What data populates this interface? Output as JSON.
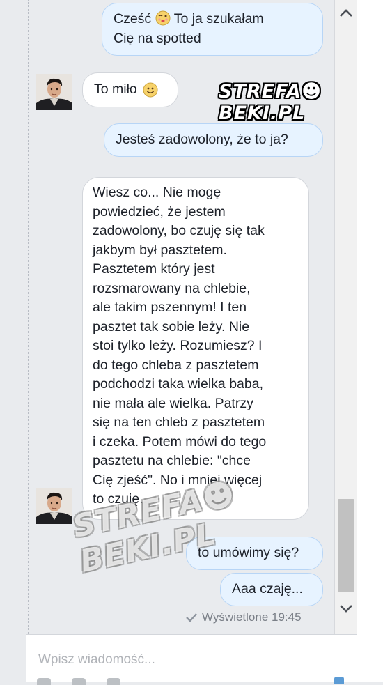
{
  "messages": [
    {
      "id": "m1",
      "side": "out",
      "text_before": "Cześć",
      "emoji": "kiss-emoji",
      "text_after": "To ja szukałam",
      "line2": "Cię na spotted"
    },
    {
      "id": "m2",
      "side": "in",
      "text": "To miło",
      "emoji": "smile-emoji"
    },
    {
      "id": "m3",
      "side": "out",
      "text": "Jesteś zadowolony, że to ja?"
    },
    {
      "id": "m4",
      "side": "in",
      "lines": [
        "Wiesz co... Nie mogę",
        "powiedzieć, że jestem",
        "zadowolony, bo czuję się tak",
        "jakbym był pasztetem.",
        "Pasztetem który jest",
        "rozsmarowany na chlebie,",
        "ale takim pszennym! I ten",
        "pasztet tak sobie leży. Nie",
        "stoi tylko leży. Rozumiesz? I",
        "do tego chleba z pasztetem",
        "podchodzi taka wielka baba,",
        "nie mała ale wielka. Patrzy",
        "się na ten chleb z pasztetem",
        "i czeka. Potem mówi do tego",
        "pasztetu na chlebie: \"chce",
        "Cię zjeść\". No i mniej więcej",
        "to czuję..."
      ]
    },
    {
      "id": "m5",
      "side": "out",
      "text": "to umówimy się?"
    },
    {
      "id": "m6",
      "side": "out",
      "text": "Aaa czaję..."
    }
  ],
  "status": {
    "seen_text": "Wyświetlone 19:45",
    "icon": "check-icon"
  },
  "watermark": {
    "text": "STREFA☻BEKI.PL"
  },
  "composer": {
    "placeholder": "Wpisz wiadomość..."
  },
  "colors": {
    "outgoing_bubble": "#e7f3ff",
    "incoming_bubble": "#ffffff",
    "background": "#e9ebee"
  }
}
